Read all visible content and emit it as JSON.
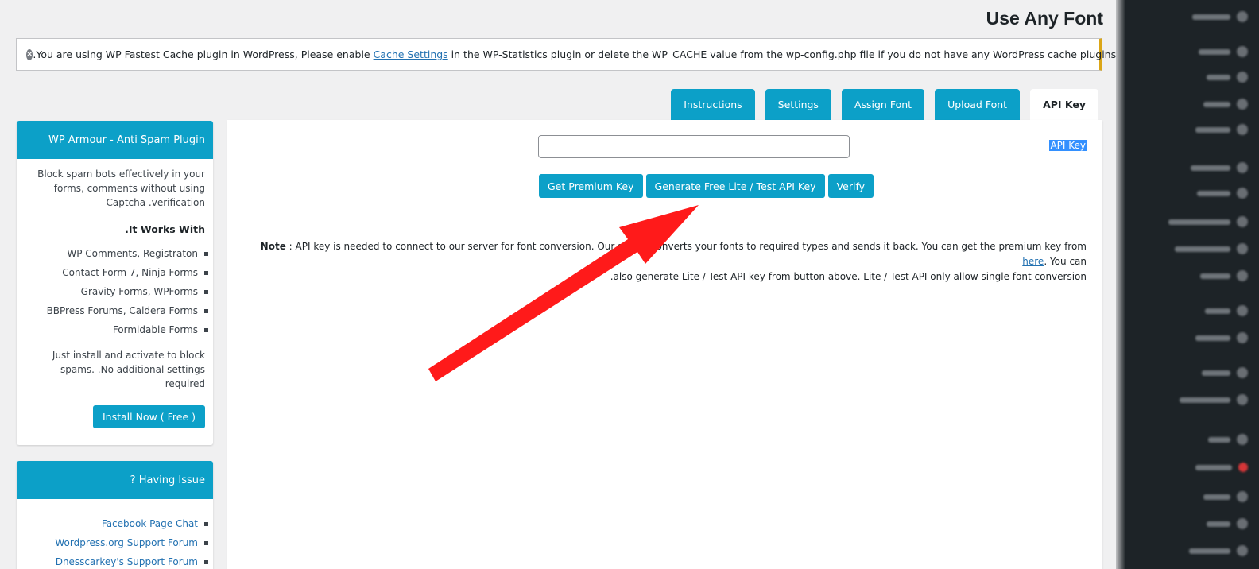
{
  "page": {
    "title": "Use Any Font"
  },
  "notice": {
    "dismiss_glyph": "×",
    "text_before": ".You are using WP Fastest Cache plugin in WordPress, Please enable ",
    "link_text": "Cache Settings",
    "text_after": " in the WP-Statistics plugin or delete the WP_CACHE value from the wp-config.php file if you do not have any WordPress cache plugins enabled"
  },
  "tabs": [
    {
      "label": "Instructions"
    },
    {
      "label": "Settings"
    },
    {
      "label": "Assign Font"
    },
    {
      "label": "Upload Font"
    },
    {
      "label": "API Key"
    }
  ],
  "sidebar": {
    "wp_armour": {
      "title": "WP Armour - Anti Spam Plugin",
      "description": "Block spam bots effectively in your forms, comments without using Captcha .verification",
      "works_with_title": ".It Works With",
      "items": [
        "WP Comments, Registraton",
        "Contact Form 7, Ninja Forms",
        "Gravity Forms, WPForms",
        "BBPress Forums, Caldera Forms",
        "Formidable Forms"
      ],
      "footer_text": "Just install and activate to block spams. .No additional settings required",
      "install_button": "Install Now ( Free )"
    },
    "having_issue": {
      "title": "? Having Issue",
      "links": [
        "Facebook Page Chat",
        "Wordpress.org Support Forum",
        "Dnesscarkey's Support Forum"
      ]
    }
  },
  "main": {
    "api_key_label": "API Key",
    "api_key_value": "",
    "buttons": {
      "premium": "Get Premium Key",
      "generate": "Generate Free Lite / Test API Key",
      "verify": "Verify"
    },
    "note": {
      "label": "Note",
      "line1_before": " : API key is needed to connect to our server for font conversion. Our server converts your fonts to required types and sends it back. You can get the premium key from ",
      "link": "here",
      "line1_after": ". You can",
      "line2": ".also generate Lite / Test API key from button above. Lite / Test API only allow single font conversion"
    }
  },
  "colors": {
    "accent": "#0ca0c8",
    "link": "#2271b1",
    "notice_border": "#dba617",
    "annotation_arrow": "#ff1a1a",
    "admin_menu": "#1d2327"
  }
}
